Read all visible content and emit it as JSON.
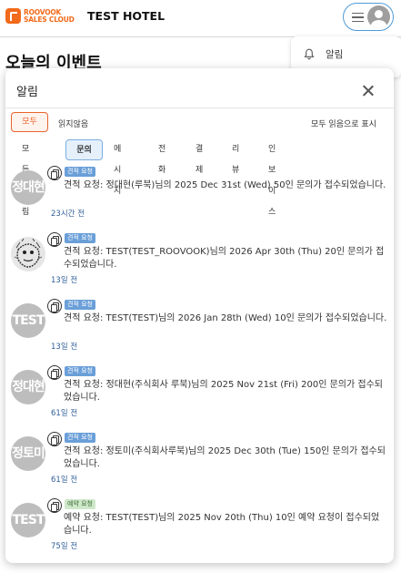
{
  "header": {
    "logo_line1": "ROOVOOK",
    "logo_line2": "SALES CLOUD",
    "hotel_name": "TEST HOTEL"
  },
  "page": {
    "title": "오늘의 이벤트"
  },
  "dropdown": {
    "notification_label": "알림"
  },
  "panel": {
    "title": "알림",
    "filter_all": "모두",
    "filter_unread": "읽지않음",
    "mark_all_read": "모두 읽음으로 표시",
    "categories": [
      "모든 알림",
      "문의",
      "메시지",
      "전화",
      "결제",
      "리뷰",
      "인보이스"
    ],
    "active_category": "문의"
  },
  "notifications": [
    {
      "avatar_text": "정대현",
      "tag": "견적 요청",
      "message": "견적 요청: 정대현(루북)님의 2025 Dec 31st (Wed) 50인 문의가 접수되었습니다.",
      "time": "23시간 전"
    },
    {
      "avatar_text": "",
      "tag": "견적 요청",
      "message": "견적 요청: TEST(TEST_ROOVOOK)님의 2026 Apr 30th (Thu) 20인 문의가 접수되었습니다.",
      "time": "13일 전"
    },
    {
      "avatar_text": "TEST",
      "tag": "견적 요청",
      "message": "견적 요청: TEST(TEST)님의 2026 Jan 28th (Wed) 10인 문의가 접수되었습니다.",
      "time": "13일 전"
    },
    {
      "avatar_text": "정대현",
      "tag": "견적 요청",
      "message": "견적 요청: 정대현(주식회사 루북)님의 2025 Nov 21st (Fri) 200인 문의가 접수되었습니다.",
      "time": "61일 전"
    },
    {
      "avatar_text": "정토미",
      "tag": "견적 요청",
      "message": "견적 요청: 정토미(주식회사루북)님의 2025 Dec 30th (Tue) 150인 문의가 접수되었습니다.",
      "time": "61일 전"
    },
    {
      "avatar_text": "TEST",
      "tag": "예약 요청",
      "message": "예약 요청: TEST(TEST)님의 2025 Nov 20th (Thu) 10인 예약 요청이 접수되었습니다.",
      "time": "75일 전"
    }
  ]
}
